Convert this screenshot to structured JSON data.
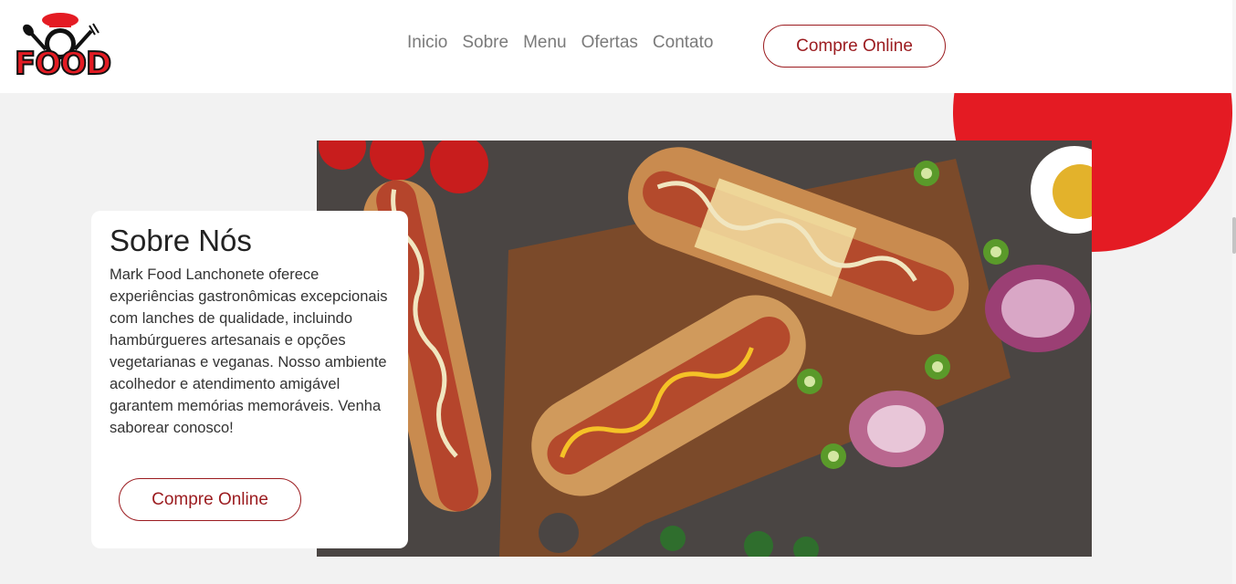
{
  "header": {
    "logo_text": "FOOD",
    "nav": [
      "Inicio",
      "Sobre",
      "Menu",
      "Ofertas",
      "Contato"
    ],
    "cta_label": "Compre Online"
  },
  "about": {
    "title": "Sobre Nós",
    "text": "Mark Food Lanchonete oferece experiências gastronômicas excepcionais com lanches de qualidade, incluindo hambúrgueres artesanais e opções vegetarianas e veganas. Nosso ambiente acolhedor e atendimento amigável garantem memórias memoráveis. Venha saborear conosco!",
    "cta_label": "Compre Online"
  },
  "colors": {
    "brand_red": "#e41b23",
    "button_red": "#9b1b1f"
  },
  "icons": {
    "logo": "chef-hat-plate-cutlery-logo",
    "photo": "hot-dogs-on-board-photo"
  }
}
